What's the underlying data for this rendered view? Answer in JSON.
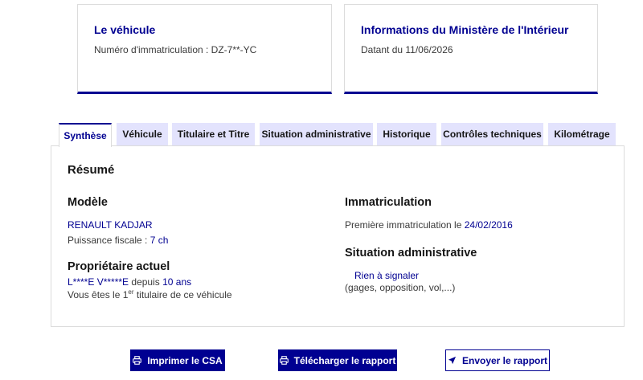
{
  "cards": [
    {
      "title": "Le véhicule",
      "subtitle": "Numéro d'immatriculation : DZ-7**-YC"
    },
    {
      "title": "Informations du Ministère de l'Intérieur",
      "subtitle": "Datant du 11/06/2026"
    }
  ],
  "tabs": [
    {
      "label": "Synthèse",
      "active": true
    },
    {
      "label": "Véhicule",
      "active": false
    },
    {
      "label": "Titulaire et Titre",
      "active": false
    },
    {
      "label": "Situation administrative",
      "active": false
    },
    {
      "label": "Historique",
      "active": false
    },
    {
      "label": "Contrôles techniques",
      "active": false
    },
    {
      "label": "Kilométrage",
      "active": false
    }
  ],
  "summary": {
    "heading": "Résumé",
    "modele": {
      "heading": "Modèle",
      "name": "RENAULT KADJAR",
      "puissance_label": "Puissance fiscale : ",
      "puissance_value": "7 ch"
    },
    "proprietaire": {
      "heading": "Propriétaire actuel",
      "name": "L****E V*****E",
      "depuis_label": " depuis ",
      "depuis_value": "10 ans",
      "titulaire_prefix": "Vous êtes le 1",
      "titulaire_sup": "er",
      "titulaire_suffix": " titulaire de ce véhicule"
    },
    "immatriculation": {
      "heading": "Immatriculation",
      "label": "Première immatriculation le ",
      "date": "24/02/2016"
    },
    "situation": {
      "heading": "Situation administrative",
      "status": "Rien à signaler",
      "details": "(gages, opposition, vol,...)"
    }
  },
  "buttons": {
    "print_csa": "Imprimer le CSA",
    "download_report": "Télécharger le rapport",
    "send_report": "Envoyer le rapport"
  },
  "colors": {
    "accent": "#000091",
    "tab_bg": "#e3e3fd"
  },
  "icons": {
    "print": "printer-icon",
    "send": "send-icon"
  }
}
